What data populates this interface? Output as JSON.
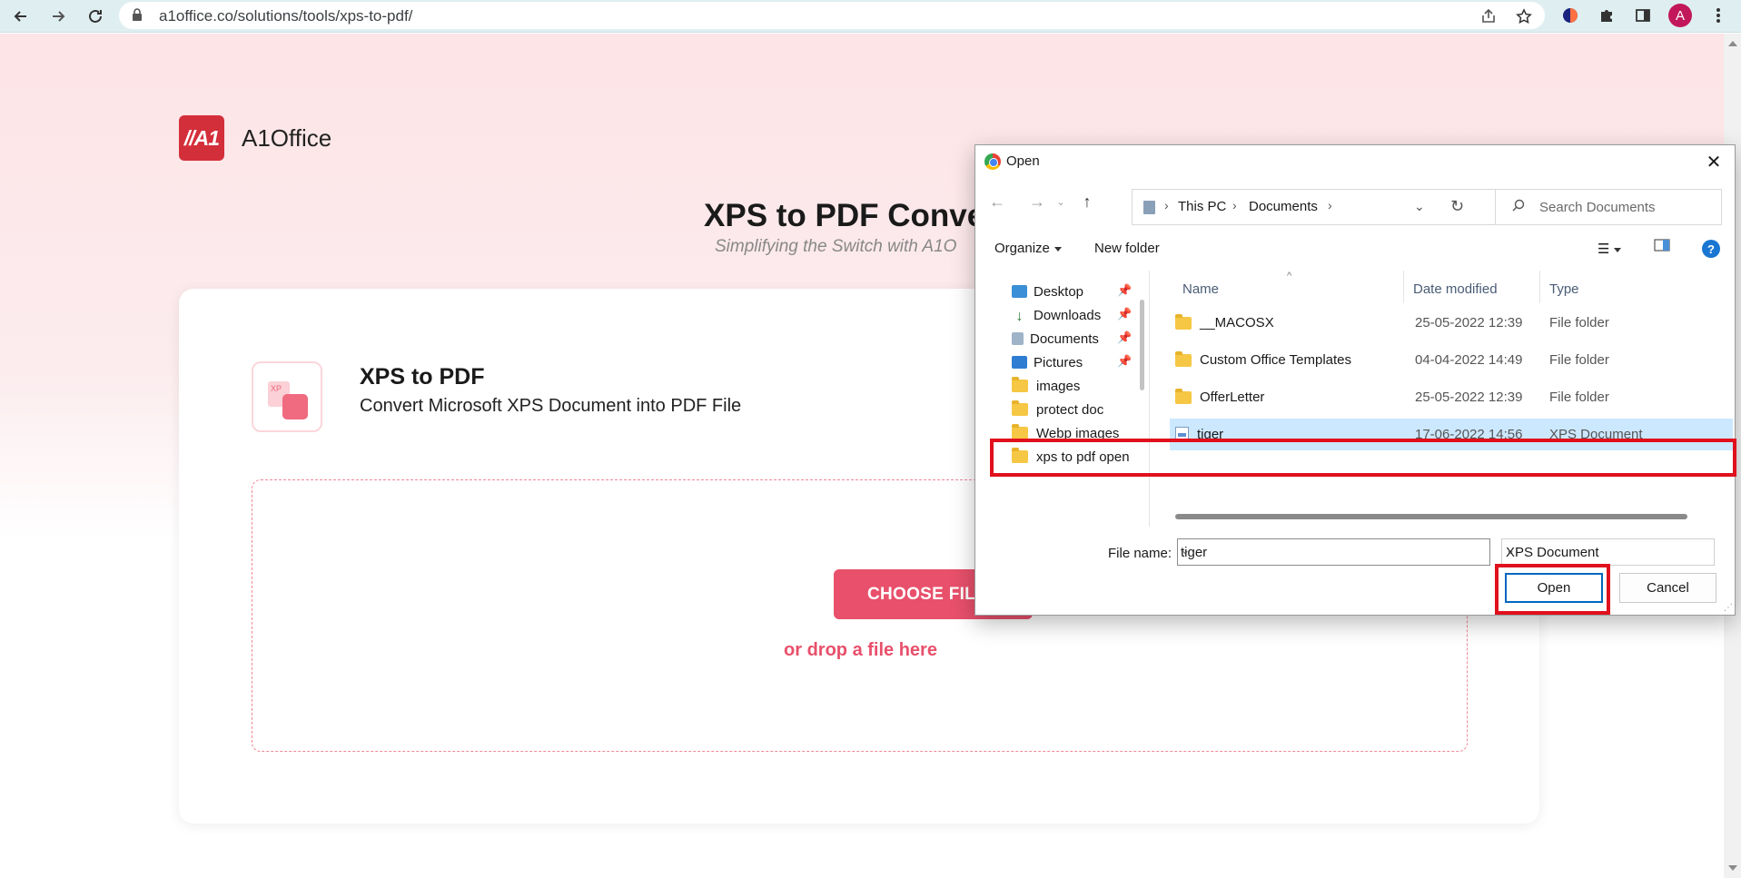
{
  "browser": {
    "url": "a1office.co/solutions/tools/xps-to-pdf/",
    "profile_initial": "A",
    "icons": [
      "back-icon",
      "forward-icon",
      "reload-icon",
      "lock-icon",
      "share-icon",
      "star-icon",
      "extension-icon",
      "puzzle-icon",
      "sidepanel-icon",
      "menu-icon"
    ]
  },
  "site": {
    "logo_mark": "//A1",
    "brand": "A1Office",
    "hero_title": "XPS to PDF Conver",
    "hero_subtitle": "Simplifying the Switch with A1O",
    "tool_title": "XPS to PDF",
    "tool_desc": "Convert Microsoft XPS Document into PDF File",
    "tool_icon_label": "XP",
    "choose_files": "CHOOSE FILES",
    "drop_text": "or drop a file here",
    "accent_color": "#e8506b"
  },
  "dialog": {
    "title": "Open",
    "breadcrumb": [
      "This PC",
      "Documents"
    ],
    "search_placeholder": "Search Documents",
    "organize": "Organize",
    "new_folder": "New folder",
    "nav_items": [
      {
        "label": "Desktop",
        "icon": "desktop-icon",
        "pinned": true
      },
      {
        "label": "Downloads",
        "icon": "downloads-icon",
        "pinned": true
      },
      {
        "label": "Documents",
        "icon": "documents-icon",
        "pinned": true
      },
      {
        "label": "Pictures",
        "icon": "pictures-icon",
        "pinned": true
      },
      {
        "label": "images",
        "icon": "folder-icon",
        "pinned": false
      },
      {
        "label": "protect doc",
        "icon": "folder-icon",
        "pinned": false
      },
      {
        "label": "Webp images",
        "icon": "folder-icon",
        "pinned": false
      },
      {
        "label": "xps to pdf open",
        "icon": "folder-icon",
        "pinned": false
      }
    ],
    "columns": {
      "name": "Name",
      "date": "Date modified",
      "type": "Type"
    },
    "files": [
      {
        "name": "__MACOSX",
        "date": "25-05-2022 12:39",
        "type": "File folder",
        "kind": "folder"
      },
      {
        "name": "Custom Office Templates",
        "date": "04-04-2022 14:49",
        "type": "File folder",
        "kind": "folder"
      },
      {
        "name": "OfferLetter",
        "date": "25-05-2022 12:39",
        "type": "File folder",
        "kind": "folder"
      },
      {
        "name": "tiger",
        "date": "17-06-2022 14:56",
        "type": "XPS Document",
        "kind": "xps",
        "selected": true
      }
    ],
    "file_name_label": "File name:",
    "file_name_value": "tiger",
    "file_type_value": "XPS Document",
    "open_label": "Open",
    "cancel_label": "Cancel",
    "highlight_color": "#e0101c"
  }
}
